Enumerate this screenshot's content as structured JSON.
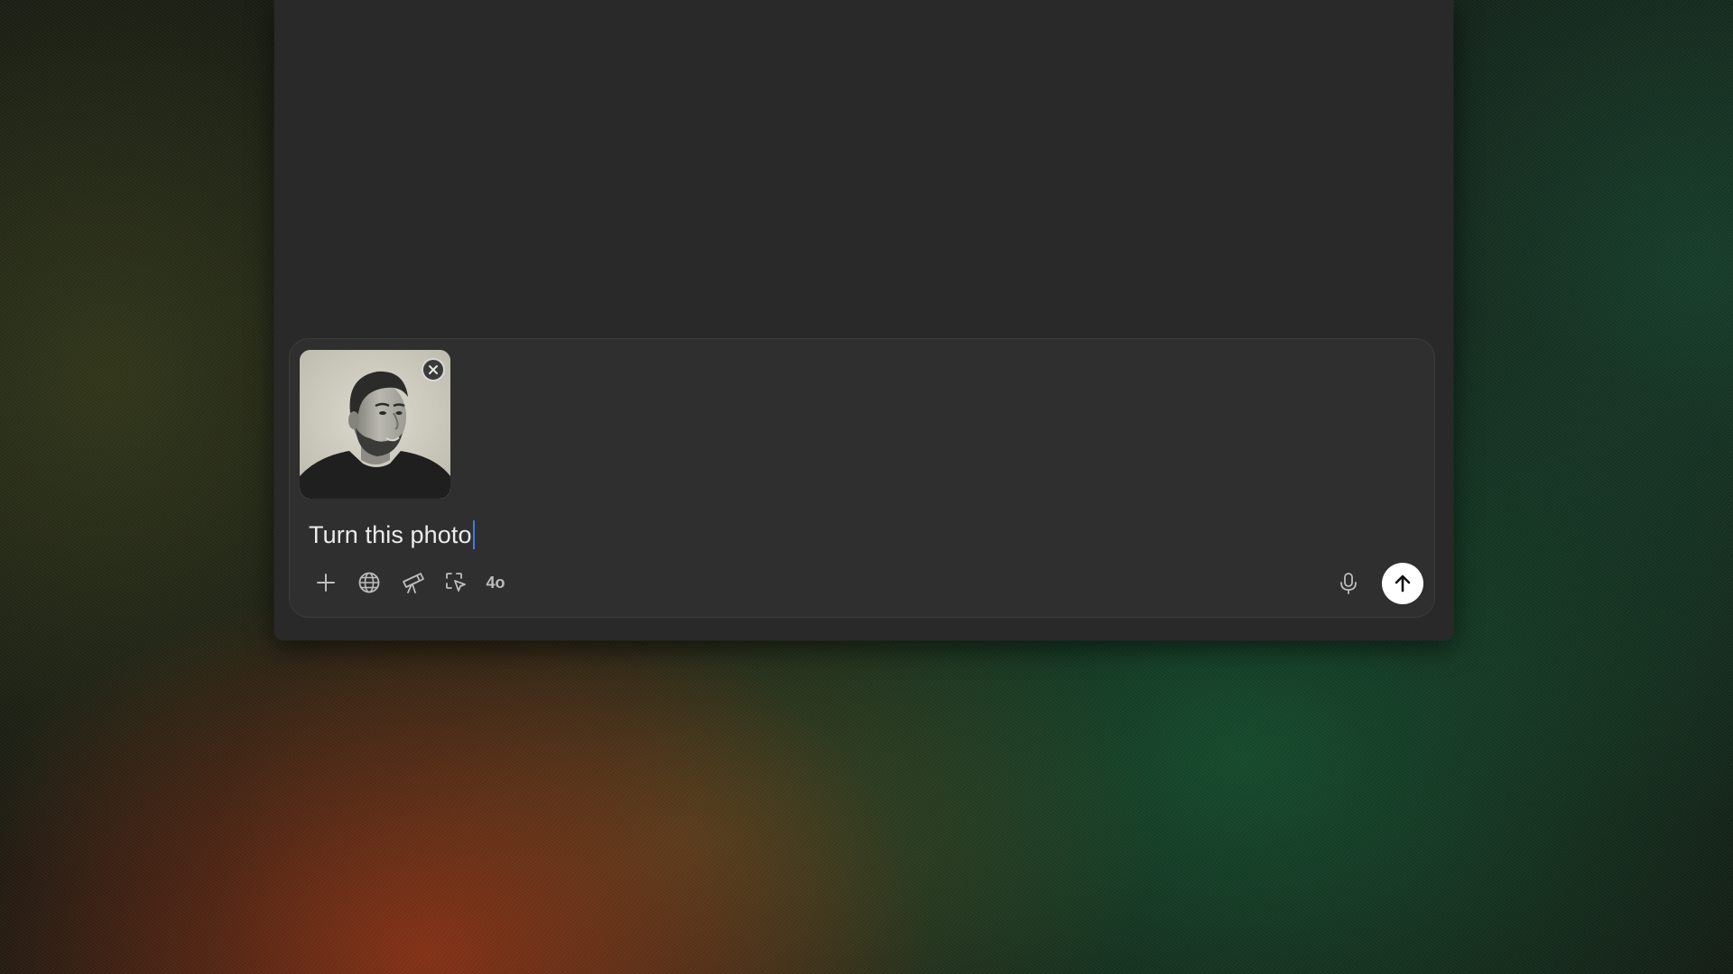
{
  "composer": {
    "prompt_text": "Turn this photo",
    "model_label": "4o",
    "attachment": {
      "kind": "image",
      "description_icon": "portrait-photo"
    }
  },
  "icons": {
    "remove": "close-icon",
    "add": "plus-icon",
    "search": "globe-icon",
    "research": "telescope-icon",
    "operator": "cursor-select-icon",
    "mic": "microphone-icon",
    "send": "arrow-up-icon"
  },
  "colors": {
    "window_bg": "#292929",
    "composer_bg": "#2f2f2f",
    "caret": "#3b7bf0",
    "send_button": "#ffffff"
  }
}
